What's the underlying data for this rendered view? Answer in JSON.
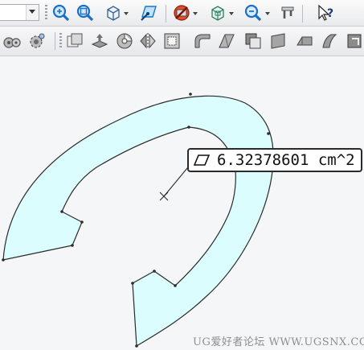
{
  "toolbar_top": {
    "combo_value": "",
    "icons": [
      "zoom-fit-icon",
      "zoom-window-icon",
      "view-orientation-icon",
      "sketch-plane-icon",
      "hide-show-icon",
      "section-view-icon",
      "zoom-options-icon",
      "measure-calipers-icon",
      "help-query-icon"
    ]
  },
  "toolbar_features": {
    "icons": [
      "gears-icon",
      "cog-icon",
      "offset-face-icon",
      "extrude-boss-icon",
      "revolve-icon",
      "mirror-icon",
      "shell-icon",
      "fillet-icon",
      "chamfer-icon",
      "rib-icon",
      "sheet-icon",
      "draft-icon",
      "surface-icon",
      "split-icon"
    ]
  },
  "viewport": {
    "measurement_label": "6.32378601 cm^2",
    "shape_fill": "#dcfdfd",
    "edge_color": "#2b2b2b"
  },
  "watermark": "UG爱好者论坛 WWW.UGSNX.COM"
}
